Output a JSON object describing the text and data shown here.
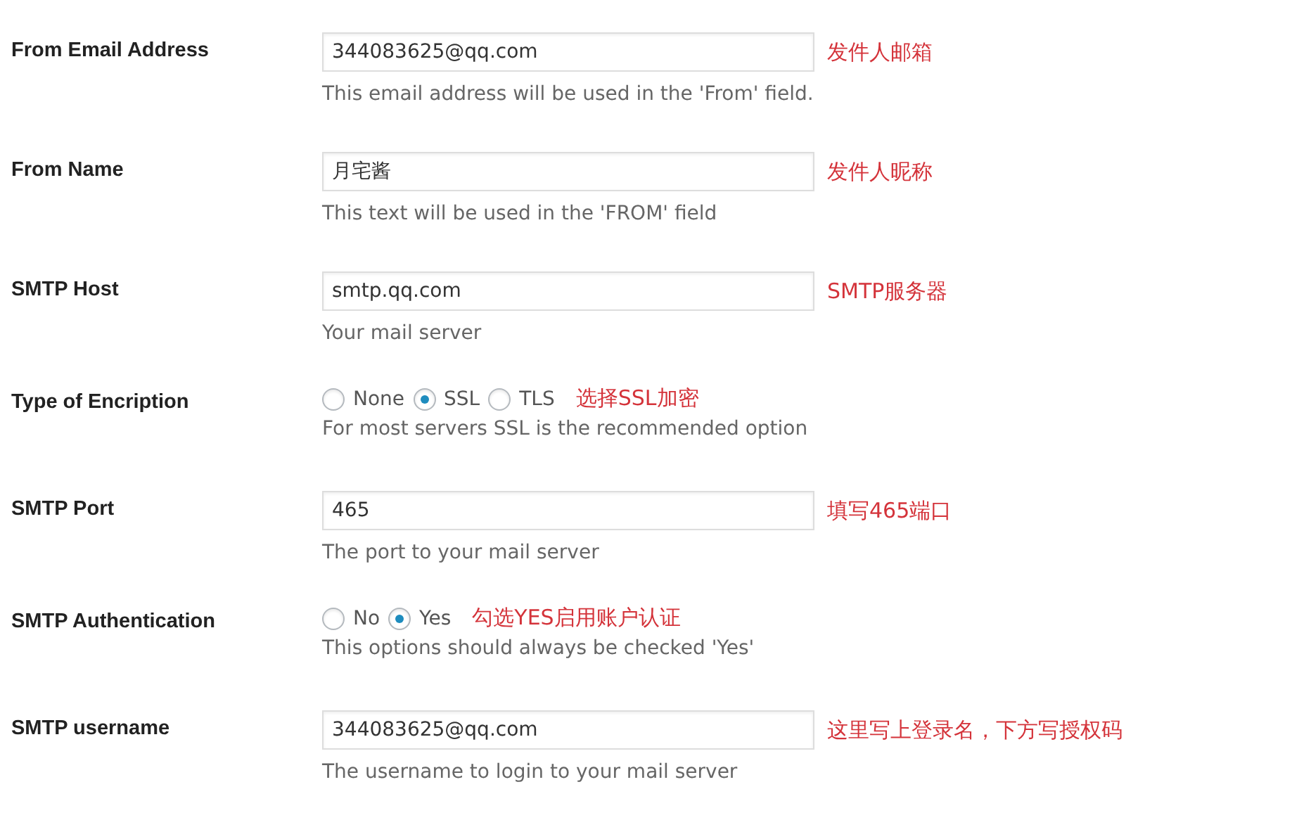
{
  "settings": [
    {
      "kind": "text",
      "label": "From Email Address",
      "value": "344083625@qq.com",
      "description": "This email address will be used in the 'From' field.",
      "note": "发件人邮箱"
    },
    {
      "kind": "text",
      "label": "From Name",
      "value": "月宅酱",
      "description": "This text will be used in the 'FROM' field",
      "note": "发件人昵称"
    },
    {
      "kind": "text",
      "label": "SMTP Host",
      "value": "smtp.qq.com",
      "description": "Your mail server",
      "note": "SMTP服务器"
    },
    {
      "kind": "radio",
      "label": "Type of Encription",
      "options": [
        {
          "label": "None",
          "selected": false
        },
        {
          "label": "SSL",
          "selected": true
        },
        {
          "label": "TLS",
          "selected": false
        }
      ],
      "description": "For most servers SSL is the recommended option",
      "note": "选择SSL加密"
    },
    {
      "kind": "text",
      "label": "SMTP Port",
      "value": "465",
      "description": "The port to your mail server",
      "note": "填写465端口"
    },
    {
      "kind": "radio",
      "label": "SMTP Authentication",
      "options": [
        {
          "label": "No",
          "selected": false
        },
        {
          "label": "Yes",
          "selected": true
        }
      ],
      "description": "This options should always be checked 'Yes'",
      "note": "勾选YES启用账户认证"
    },
    {
      "kind": "text",
      "label": "SMTP username",
      "value": "344083625@qq.com",
      "description": "The username to login to your mail server",
      "note": "这里写上登录名，下方写授权码"
    }
  ]
}
